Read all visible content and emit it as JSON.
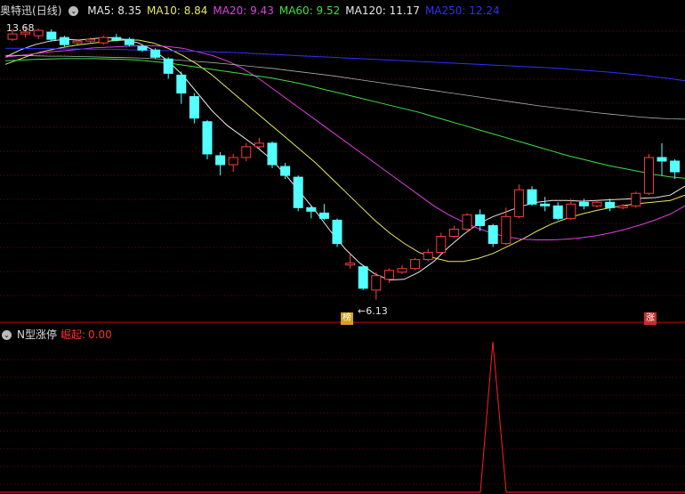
{
  "main_legend": {
    "stock_name": "奥特迅",
    "period": "(日线)",
    "items": [
      {
        "label": "MA5:",
        "value": "8.35",
        "color": "#e8e8e8"
      },
      {
        "label": "MA10:",
        "value": "8.84",
        "color": "#e8e860"
      },
      {
        "label": "MA20:",
        "value": "9.43",
        "color": "#e040e0"
      },
      {
        "label": "MA60:",
        "value": "9.52",
        "color": "#40e040"
      },
      {
        "label": "MA120:",
        "value": "11.17",
        "color": "#e8e8e8"
      },
      {
        "label": "MA250:",
        "value": "12.24",
        "color": "#3030ff"
      }
    ]
  },
  "sub_legend": {
    "indicator": "N型涨停",
    "label": "崛起:",
    "value": "0.00",
    "label_color": "#ff3030"
  },
  "annotations": {
    "high_label": "13.68",
    "low_label": "6.13",
    "low_arrow": "←"
  },
  "markers": {
    "bottom_tag_1": "榜",
    "bottom_tag_2": "涨"
  },
  "colors": {
    "up": "#ff3c3c",
    "down": "#54ffff",
    "grid": "#7a0000",
    "background": "#000000"
  },
  "chart_data": [
    {
      "type": "candlestick",
      "series": [
        {
          "name": "MA5",
          "values": [
            12.9,
            13.1,
            13.25,
            13.35,
            13.4,
            13.38,
            13.42,
            13.45,
            13.4,
            13.3,
            13.1,
            12.8,
            12.4,
            11.9,
            11.4,
            11.0,
            10.7,
            10.4,
            10.05,
            9.6,
            9.1,
            8.6,
            8.05,
            7.55,
            7.15,
            6.85,
            6.68,
            6.7,
            6.9,
            7.2,
            7.6,
            7.95,
            8.25,
            8.45,
            8.6,
            8.75,
            8.85,
            8.9,
            8.9,
            8.88,
            8.9,
            8.92,
            8.94,
            8.96,
            8.98,
            9.05,
            9.3
          ]
        },
        {
          "name": "MA10",
          "values": [
            12.7,
            12.85,
            13.0,
            13.1,
            13.18,
            13.25,
            13.3,
            13.35,
            13.38,
            13.38,
            13.3,
            13.15,
            12.95,
            12.7,
            12.4,
            12.05,
            11.7,
            11.35,
            11.0,
            10.65,
            10.3,
            9.95,
            9.55,
            9.15,
            8.75,
            8.35,
            8.0,
            7.7,
            7.45,
            7.3,
            7.2,
            7.2,
            7.28,
            7.42,
            7.62,
            7.82,
            8.05,
            8.25,
            8.4,
            8.52,
            8.62,
            8.7,
            8.77,
            8.82,
            8.86,
            8.9,
            9.05
          ]
        },
        {
          "name": "MA20",
          "values": [
            12.9,
            12.95,
            13.0,
            13.05,
            13.08,
            13.12,
            13.16,
            13.18,
            13.2,
            13.22,
            13.22,
            13.2,
            13.15,
            13.05,
            12.95,
            12.8,
            12.6,
            12.35,
            12.05,
            11.75,
            11.45,
            11.15,
            10.85,
            10.55,
            10.25,
            9.95,
            9.65,
            9.35,
            9.05,
            8.75,
            8.5,
            8.3,
            8.12,
            7.98,
            7.88,
            7.82,
            7.8,
            7.8,
            7.82,
            7.86,
            7.92,
            8.0,
            8.1,
            8.22,
            8.36,
            8.52,
            8.75
          ]
        },
        {
          "name": "MA60",
          "values": [
            12.8,
            12.82,
            12.84,
            12.85,
            12.86,
            12.86,
            12.86,
            12.85,
            12.84,
            12.82,
            12.78,
            12.74,
            12.68,
            12.62,
            12.56,
            12.5,
            12.44,
            12.38,
            12.32,
            12.24,
            12.16,
            12.06,
            11.96,
            11.86,
            11.76,
            11.66,
            11.56,
            11.46,
            11.36,
            11.24,
            11.12,
            11.0,
            10.88,
            10.76,
            10.64,
            10.52,
            10.4,
            10.28,
            10.16,
            10.06,
            9.96,
            9.86,
            9.78,
            9.7,
            9.62,
            9.56,
            9.52
          ]
        },
        {
          "name": "MA120",
          "values": [
            12.95,
            12.95,
            12.94,
            12.93,
            12.93,
            12.92,
            12.91,
            12.9,
            12.89,
            12.88,
            12.86,
            12.84,
            12.81,
            12.78,
            12.75,
            12.71,
            12.67,
            12.63,
            12.59,
            12.54,
            12.49,
            12.44,
            12.39,
            12.33,
            12.27,
            12.21,
            12.15,
            12.09,
            12.03,
            11.97,
            11.91,
            11.85,
            11.79,
            11.73,
            11.67,
            11.61,
            11.55,
            11.5,
            11.45,
            11.4,
            11.35,
            11.31,
            11.27,
            11.23,
            11.2,
            11.18,
            11.17
          ]
        },
        {
          "name": "MA250",
          "values": [
            13.15,
            13.15,
            13.14,
            13.14,
            13.13,
            13.13,
            13.12,
            13.12,
            13.11,
            13.1,
            13.09,
            13.08,
            13.07,
            13.06,
            13.05,
            13.04,
            13.02,
            13.0,
            12.98,
            12.96,
            12.94,
            12.92,
            12.9,
            12.88,
            12.86,
            12.84,
            12.82,
            12.8,
            12.78,
            12.76,
            12.74,
            12.72,
            12.7,
            12.68,
            12.66,
            12.64,
            12.62,
            12.6,
            12.57,
            12.54,
            12.51,
            12.48,
            12.44,
            12.4,
            12.35,
            12.3,
            12.24
          ]
        }
      ],
      "candles": [
        [
          13.4,
          13.55,
          13.7,
          13.35
        ],
        [
          13.55,
          13.6,
          13.75,
          13.45
        ],
        [
          13.5,
          13.65,
          13.7,
          13.4
        ],
        [
          13.6,
          13.4,
          13.68,
          13.35
        ],
        [
          13.45,
          13.25,
          13.5,
          13.2
        ],
        [
          13.3,
          13.35,
          13.4,
          13.25
        ],
        [
          13.35,
          13.4,
          13.45,
          13.3
        ],
        [
          13.3,
          13.45,
          13.5,
          13.25
        ],
        [
          13.45,
          13.38,
          13.55,
          13.35
        ],
        [
          13.4,
          13.25,
          13.45,
          13.2
        ],
        [
          13.2,
          13.1,
          13.25,
          13.05
        ],
        [
          13.1,
          12.9,
          13.15,
          12.85
        ],
        [
          12.85,
          12.45,
          12.9,
          12.3
        ],
        [
          12.4,
          11.9,
          12.5,
          11.6
        ],
        [
          11.8,
          11.2,
          11.9,
          11.05
        ],
        [
          11.1,
          10.2,
          11.15,
          10.05
        ],
        [
          10.15,
          9.9,
          10.25,
          9.6
        ],
        [
          9.9,
          10.1,
          10.2,
          9.7
        ],
        [
          10.1,
          10.4,
          10.5,
          10.0
        ],
        [
          10.4,
          10.5,
          10.65,
          10.35
        ],
        [
          10.5,
          9.9,
          10.55,
          9.8
        ],
        [
          9.85,
          9.6,
          9.95,
          9.5
        ],
        [
          9.55,
          8.7,
          9.6,
          8.6
        ],
        [
          8.7,
          8.6,
          8.75,
          8.4
        ],
        [
          8.55,
          8.4,
          8.8,
          8.35
        ],
        [
          8.35,
          7.7,
          8.4,
          7.6
        ],
        [
          7.1,
          7.15,
          7.4,
          7.0
        ],
        [
          7.05,
          6.45,
          7.1,
          6.4
        ],
        [
          6.4,
          6.8,
          6.9,
          6.13
        ],
        [
          6.7,
          6.95,
          7.0,
          6.6
        ],
        [
          6.9,
          7.0,
          7.1,
          6.85
        ],
        [
          7.0,
          7.25,
          7.3,
          6.95
        ],
        [
          7.25,
          7.45,
          7.55,
          7.2
        ],
        [
          7.45,
          7.9,
          8.0,
          7.4
        ],
        [
          7.9,
          8.1,
          8.2,
          7.85
        ],
        [
          8.1,
          8.5,
          8.55,
          8.0
        ],
        [
          8.5,
          8.2,
          8.65,
          8.05
        ],
        [
          8.2,
          7.7,
          8.25,
          7.6
        ],
        [
          7.7,
          8.45,
          8.7,
          7.65
        ],
        [
          8.45,
          9.2,
          9.35,
          8.4
        ],
        [
          9.2,
          8.8,
          9.3,
          8.75
        ],
        [
          8.8,
          8.75,
          9.0,
          8.6
        ],
        [
          8.75,
          8.4,
          8.85,
          8.35
        ],
        [
          8.4,
          8.8,
          8.95,
          8.35
        ],
        [
          8.85,
          8.75,
          8.95,
          8.65
        ],
        [
          8.75,
          8.85,
          8.9,
          8.7
        ],
        [
          8.85,
          8.7,
          8.95,
          8.6
        ],
        [
          8.7,
          8.75,
          8.8,
          8.65
        ],
        [
          8.75,
          9.1,
          9.15,
          8.7
        ],
        [
          9.1,
          10.1,
          10.2,
          9.05
        ],
        [
          10.1,
          10.0,
          10.5,
          9.6
        ],
        [
          10.0,
          9.7,
          10.05,
          9.5
        ]
      ],
      "annotations": [
        {
          "text": "13.68"
        },
        {
          "text": "6.13"
        }
      ]
    },
    {
      "type": "line",
      "series": [
        {
          "name": "崛起",
          "values": [
            0,
            0,
            0,
            0,
            0,
            0,
            0,
            0,
            0,
            0,
            0,
            0,
            0,
            0,
            0,
            0,
            0,
            0,
            0,
            0,
            0,
            0,
            0,
            0,
            0,
            0,
            0,
            0,
            0,
            0,
            0,
            0,
            0,
            0,
            0,
            0,
            0,
            0,
            0,
            0,
            0,
            1,
            0,
            0,
            0,
            0,
            0,
            0,
            0,
            0,
            0,
            0
          ]
        }
      ],
      "ylim": [
        0,
        1
      ]
    }
  ]
}
